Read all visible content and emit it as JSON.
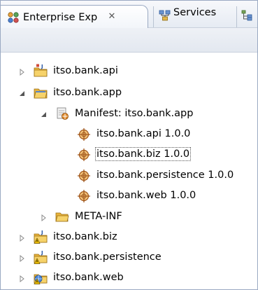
{
  "tabs": [
    {
      "label": "Enterprise Exp",
      "close": "✕",
      "icon": "enterprise-explorer-icon",
      "active": true
    },
    {
      "label": "Services",
      "icon": "services-icon",
      "active": false
    },
    {
      "label": "",
      "icon": "outline-icon",
      "active": false
    }
  ],
  "tree": {
    "items": [
      {
        "label": "itso.bank.api",
        "icon": "java-project-icon",
        "expanded": false
      },
      {
        "label": "itso.bank.app",
        "icon": "java-project-icon",
        "expanded": true
      },
      {
        "label": "Manifest: itso.bank.app",
        "icon": "manifest-icon",
        "expanded": true
      },
      {
        "label": "itso.bank.api 1.0.0",
        "icon": "bundle-icon"
      },
      {
        "label": "itso.bank.biz 1.0.0",
        "icon": "bundle-icon",
        "selected": true
      },
      {
        "label": "itso.bank.persistence 1.0.0",
        "icon": "bundle-icon"
      },
      {
        "label": "itso.bank.web 1.0.0",
        "icon": "bundle-icon"
      },
      {
        "label": "META-INF",
        "icon": "folder-icon",
        "expanded": false
      },
      {
        "label": "itso.bank.biz",
        "icon": "java-project-warning-icon",
        "expanded": false
      },
      {
        "label": "itso.bank.persistence",
        "icon": "java-project-warning-icon",
        "expanded": false
      },
      {
        "label": "itso.bank.web",
        "icon": "web-project-icon",
        "expanded": false
      }
    ]
  },
  "colors": {
    "accent": "#9aa9c2",
    "folder": "#e8b33d",
    "bundle": "#c0681e",
    "warning": "#f2c200"
  }
}
